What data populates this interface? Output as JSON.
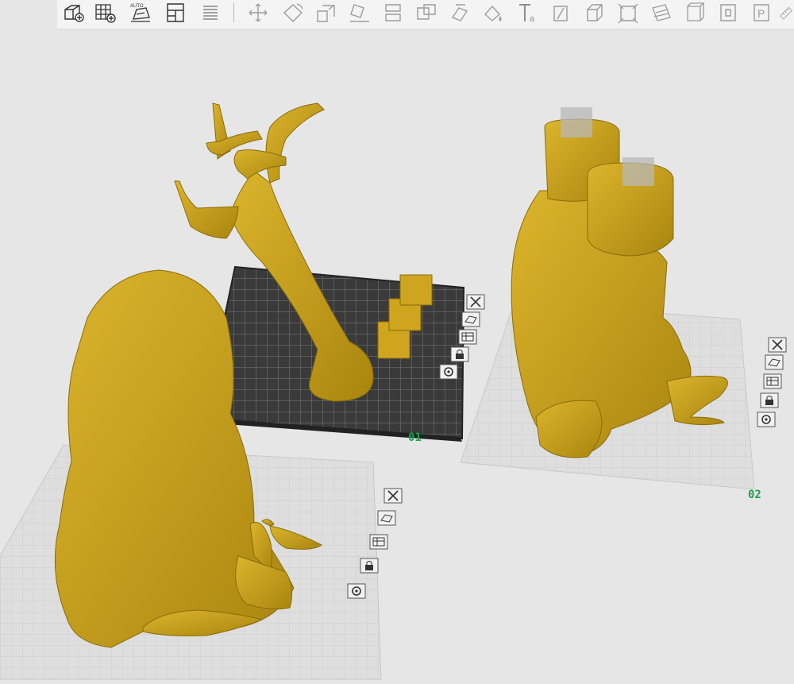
{
  "toolbar": {
    "tools": [
      {
        "name": "add-plate-icon",
        "enabled": true
      },
      {
        "name": "grid-add-icon",
        "enabled": true
      },
      {
        "name": "auto-arrange-icon",
        "enabled": true,
        "label": "AUTO"
      },
      {
        "name": "plate-layout-icon",
        "enabled": true
      },
      {
        "name": "layers-stack-icon",
        "enabled": true
      },
      {
        "name": "move-icon",
        "enabled": false
      },
      {
        "name": "rotate-icon",
        "enabled": false
      },
      {
        "name": "scale-icon",
        "enabled": false
      },
      {
        "name": "lay-on-face-icon",
        "enabled": false
      },
      {
        "name": "cut-icon",
        "enabled": false
      },
      {
        "name": "boolean-icon",
        "enabled": false
      },
      {
        "name": "support-paint-icon",
        "enabled": false
      },
      {
        "name": "color-paint-icon",
        "enabled": false
      },
      {
        "name": "text-icon",
        "enabled": false
      },
      {
        "name": "seam-paint-icon",
        "enabled": false
      },
      {
        "name": "hollow-icon",
        "enabled": false
      },
      {
        "name": "measure-box-icon",
        "enabled": false
      },
      {
        "name": "mesh-repair-icon",
        "enabled": false
      },
      {
        "name": "variable-layer-icon",
        "enabled": false
      },
      {
        "name": "assembly-icon",
        "enabled": false
      },
      {
        "name": "plate-p-icon",
        "enabled": false
      },
      {
        "name": "ruler-icon",
        "enabled": false
      }
    ],
    "text_tool_suffix": "a"
  },
  "viewport": {
    "plates": [
      {
        "label": "01"
      },
      {
        "label": "02"
      }
    ],
    "plate_tools": [
      "close-plate-icon",
      "arrange-plate-icon",
      "plate-settings-icon",
      "lock-plate-icon",
      "plate-gear-icon"
    ],
    "colors": {
      "background": "#e6e6e6",
      "model": "#c9a21a",
      "active_plate": "#3a3a3a",
      "plate_grid": "#d6d6d6",
      "label": "#17a34a"
    }
  }
}
